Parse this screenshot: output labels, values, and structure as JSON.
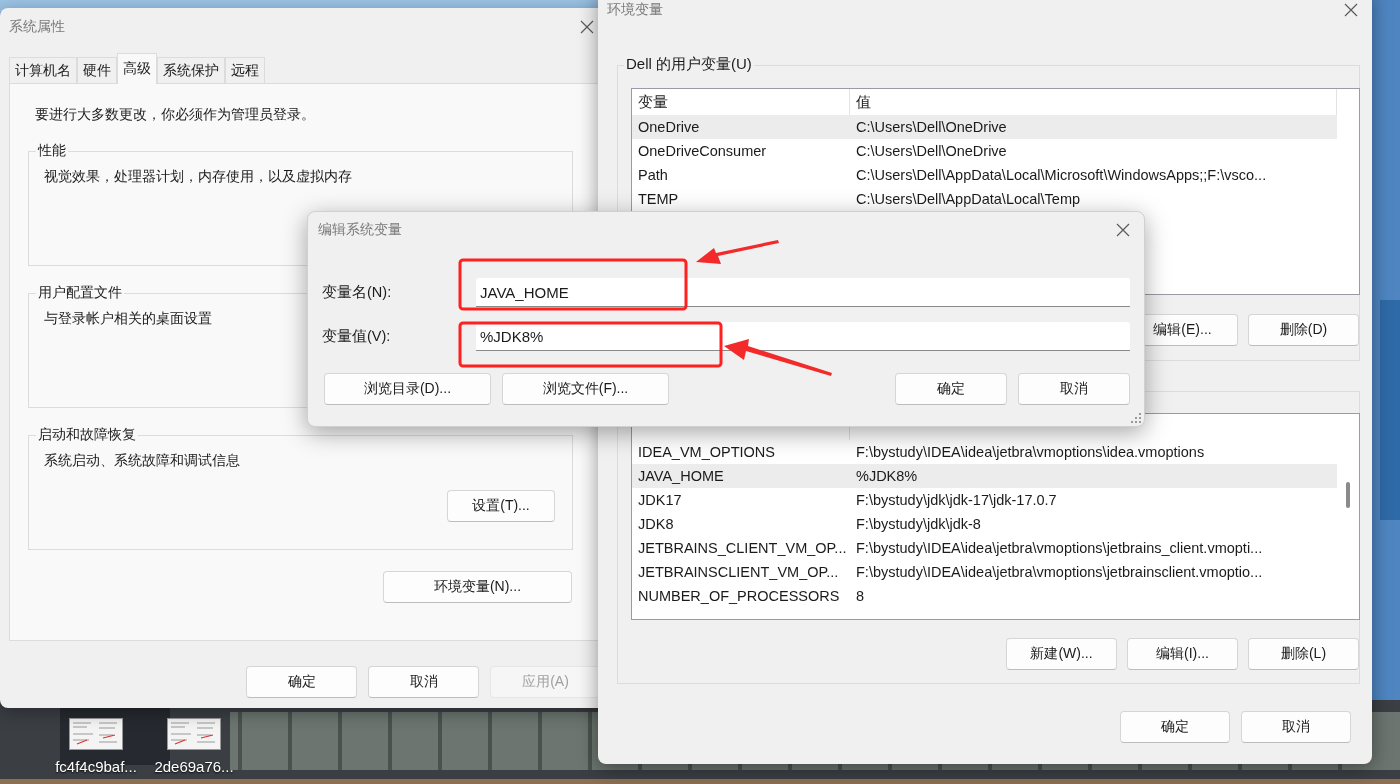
{
  "system_properties": {
    "title": "系统属性",
    "tabs": [
      {
        "label": "计算机名",
        "selected": false
      },
      {
        "label": "硬件",
        "selected": false
      },
      {
        "label": "高级",
        "selected": true
      },
      {
        "label": "系统保护",
        "selected": false
      },
      {
        "label": "远程",
        "selected": false
      }
    ],
    "notice": "要进行大多数更改，你必须作为管理员登录。",
    "groups": [
      {
        "title": "性能",
        "description": "视觉效果，处理器计划，内存使用，以及虚拟内存"
      },
      {
        "title": "用户配置文件",
        "description": "与登录帐户相关的桌面设置"
      },
      {
        "title": "启动和故障恢复",
        "description": "系统启动、系统故障和调试信息",
        "button": "设置(T)..."
      }
    ],
    "env_button": "环境变量(N)...",
    "buttons": [
      {
        "label": "确定",
        "disabled": false
      },
      {
        "label": "取消",
        "disabled": false
      },
      {
        "label": "应用(A)",
        "disabled": true
      }
    ]
  },
  "environment_variables": {
    "title": "环境变量",
    "user_group_title": "Dell 的用户变量(U)",
    "user_table": {
      "columns": [
        "变量",
        "值"
      ],
      "rows": [
        {
          "name": "OneDrive",
          "value": "C:\\Users\\Dell\\OneDrive",
          "selected": true
        },
        {
          "name": "OneDriveConsumer",
          "value": "C:\\Users\\Dell\\OneDrive",
          "selected": false
        },
        {
          "name": "Path",
          "value": "C:\\Users\\Dell\\AppData\\Local\\Microsoft\\WindowsApps;;F:\\vsco...",
          "selected": false
        },
        {
          "name": "TEMP",
          "value": "C:\\Users\\Dell\\AppData\\Local\\Temp",
          "selected": false
        }
      ]
    },
    "user_buttons": [
      "编辑(E)...",
      "删除(D)"
    ],
    "system_table": {
      "rows": [
        {
          "name": "IDEA_VM_OPTIONS",
          "value": "F:\\bystudy\\IDEA\\idea\\jetbra\\vmoptions\\idea.vmoptions",
          "selected": false
        },
        {
          "name": "JAVA_HOME",
          "value": "%JDK8%",
          "selected": true
        },
        {
          "name": "JDK17",
          "value": "F:\\bystudy\\jdk\\jdk-17\\jdk-17.0.7",
          "selected": false
        },
        {
          "name": "JDK8",
          "value": "F:\\bystudy\\jdk\\jdk-8",
          "selected": false
        },
        {
          "name": "JETBRAINS_CLIENT_VM_OP...",
          "value": "F:\\bystudy\\IDEA\\idea\\jetbra\\vmoptions\\jetbrains_client.vmopti...",
          "selected": false
        },
        {
          "name": "JETBRAINSCLIENT_VM_OP...",
          "value": "F:\\bystudy\\IDEA\\idea\\jetbra\\vmoptions\\jetbrainsclient.vmoptio...",
          "selected": false
        },
        {
          "name": "NUMBER_OF_PROCESSORS",
          "value": "8",
          "selected": false
        }
      ]
    },
    "system_buttons": [
      "新建(W)...",
      "编辑(I)...",
      "删除(L)"
    ],
    "buttons": [
      "确定",
      "取消"
    ]
  },
  "edit_dialog": {
    "title": "编辑系统变量",
    "fields": [
      {
        "label": "变量名(N):",
        "value": "JAVA_HOME"
      },
      {
        "label": "变量值(V):",
        "value": "%JDK8%"
      }
    ],
    "browse_buttons": [
      "浏览目录(D)...",
      "浏览文件(F)..."
    ],
    "buttons": [
      "确定",
      "取消"
    ]
  },
  "desktop_icons": [
    {
      "label": "fc4f4c9baf..."
    },
    {
      "label": "2de69a76..."
    }
  ]
}
